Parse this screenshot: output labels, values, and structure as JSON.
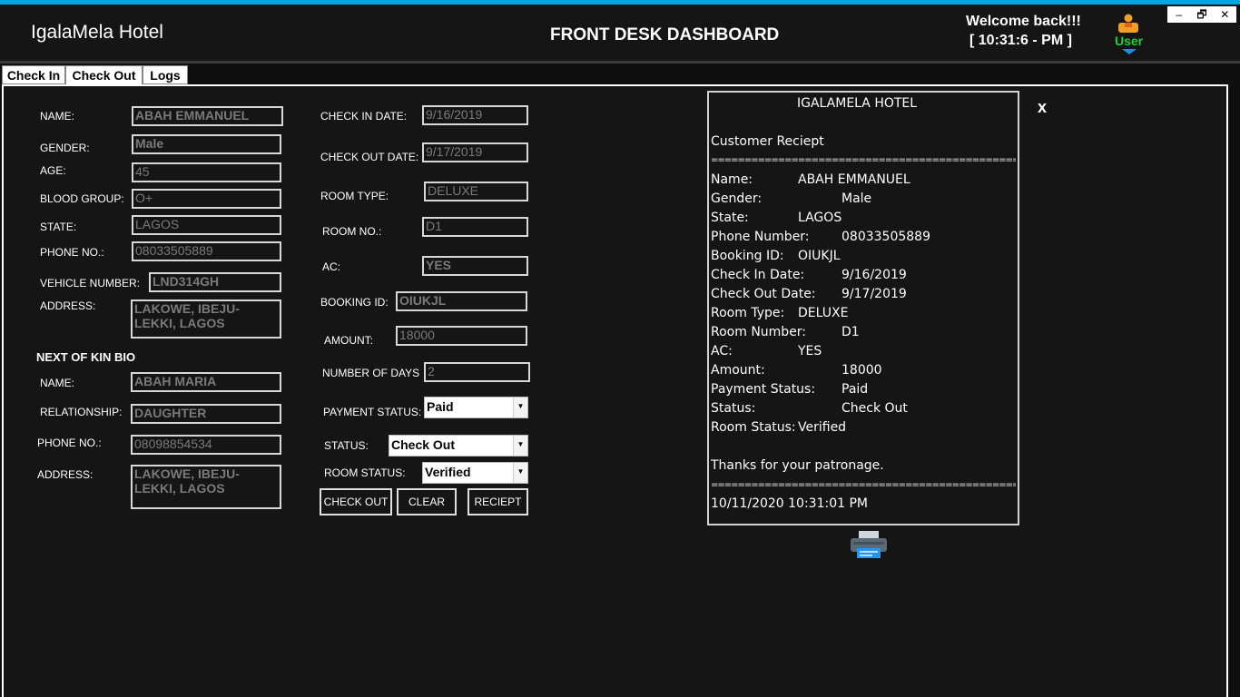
{
  "header": {
    "app_title": "IgalaMela Hotel",
    "dashboard_title": "FRONT DESK DASHBOARD",
    "welcome": "Welcome back!!!",
    "clock": "[ 10:31:6 - PM ]",
    "user_label": "User",
    "window_buttons": [
      "–",
      "🗗",
      "✕"
    ]
  },
  "tabs": [
    "Check In",
    "Check Out",
    "Logs"
  ],
  "guest": {
    "labels": {
      "name": "NAME:",
      "gender": "GENDER:",
      "age": "AGE:",
      "blood_group": "BLOOD GROUP:",
      "state": "STATE:",
      "phone": "PHONE NO.:",
      "vehicle": "VEHICLE NUMBER:",
      "address": "ADDRESS:"
    },
    "values": {
      "name": "ABAH EMMANUEL",
      "gender": "Male",
      "age": "45",
      "blood_group": "O+",
      "state": "LAGOS",
      "phone": "08033505889",
      "vehicle": "LND314GH",
      "address": "LAKOWE, IBEJU-LEKKI, LAGOS"
    }
  },
  "kin": {
    "title": "NEXT OF KIN BIO",
    "labels": {
      "name": "NAME:",
      "relationship": "RELATIONSHIP:",
      "phone": "PHONE NO.:",
      "address": "ADDRESS:"
    },
    "values": {
      "name": "ABAH MARIA",
      "relationship": "DAUGHTER",
      "phone": "08098854534",
      "address": "LAKOWE, IBEJU-LEKKI, LAGOS"
    }
  },
  "booking": {
    "labels": {
      "check_in": "CHECK IN DATE:",
      "check_out": "CHECK OUT DATE:",
      "room_type": "ROOM TYPE:",
      "room_no": "ROOM NO.:",
      "ac": "AC:",
      "booking_id": "BOOKING ID:",
      "amount": "AMOUNT:",
      "days": "NUMBER OF DAYS",
      "payment_status": "PAYMENT STATUS:",
      "status": "STATUS:",
      "room_status": "ROOM STATUS:"
    },
    "values": {
      "check_in": "9/16/2019",
      "check_out": "9/17/2019",
      "room_type": "DELUXE",
      "room_no": "D1",
      "ac": "YES",
      "booking_id": "OIUKJL",
      "amount": "18000",
      "days": "2",
      "payment_status": "Paid",
      "status": "Check Out",
      "room_status": "Verified"
    }
  },
  "buttons": {
    "check_out": "CHECK OUT",
    "clear": "CLEAR",
    "receipt": "RECIEPT"
  },
  "receipt": {
    "hotel": "IGALAMELA HOTEL",
    "heading": "Customer Reciept",
    "separator": "================================================",
    "rows": [
      {
        "k": "Name:",
        "v": "ABAH EMMANUEL"
      },
      {
        "k": "Gender:",
        "v": "Male"
      },
      {
        "k": "State:",
        "v": "LAGOS"
      },
      {
        "k": "Phone Number:",
        "v": "08033505889"
      },
      {
        "k": "Booking ID:",
        "v": "OIUKJL"
      },
      {
        "k": "Check In Date:",
        "v": "9/16/2019"
      },
      {
        "k": "Check Out Date:",
        "v": "9/17/2019"
      },
      {
        "k": "Room Type:",
        "v": "DELUXE"
      },
      {
        "k": "Room Number:",
        "v": "D1"
      },
      {
        "k": "AC:",
        "v": "YES"
      },
      {
        "k": "Amount:",
        "v": "18000"
      },
      {
        "k": "Payment Status:",
        "v": "Paid"
      },
      {
        "k": "Status:",
        "v": "Check Out"
      },
      {
        "k": "Room Status:",
        "v": "Verified"
      }
    ],
    "thanks": "Thanks for your patronage.",
    "timestamp": "10/11/2020 10:31:01 PM",
    "close": "x"
  },
  "icons": {
    "user": "user-icon",
    "printer": "printer-icon"
  },
  "colors": {
    "accent_strip": "#0aa2e0",
    "user_label": "#17d335"
  }
}
